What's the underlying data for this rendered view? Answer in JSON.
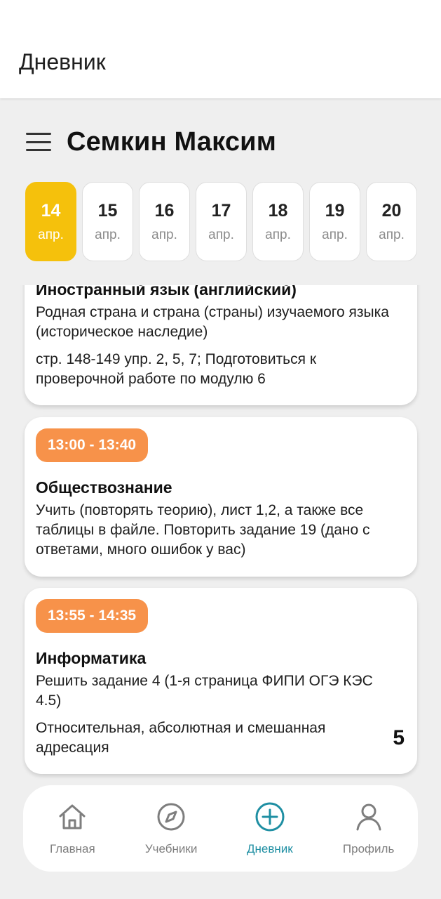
{
  "app_bar": {
    "title": "Дневник"
  },
  "header": {
    "student_name": "Семкин Максим"
  },
  "dates": [
    {
      "day": "14",
      "month": "апр.",
      "active": true
    },
    {
      "day": "15",
      "month": "апр.",
      "active": false
    },
    {
      "day": "16",
      "month": "апр.",
      "active": false
    },
    {
      "day": "17",
      "month": "апр.",
      "active": false
    },
    {
      "day": "18",
      "month": "апр.",
      "active": false
    },
    {
      "day": "19",
      "month": "апр.",
      "active": false
    },
    {
      "day": "20",
      "month": "апр.",
      "active": false
    }
  ],
  "lessons": [
    {
      "time": "",
      "subject": "Иностранный язык (английский)",
      "topic": "Родная страна и страна (страны) изучаемого языка (историческое наследие)",
      "homework": "стр. 148-149 упр. 2, 5, 7; Подготовиться к проверочной работе по модулю 6",
      "grade": ""
    },
    {
      "time": "13:00 - 13:40",
      "subject": "Обществознание",
      "topic": "Учить (повторять теорию), лист 1,2, а также все таблицы в файле. Повторить задание 19 (дано с ответами, много ошибок у вас)",
      "homework": "",
      "grade": ""
    },
    {
      "time": "13:55 - 14:35",
      "subject": "Информатика",
      "topic": "Решить задание 4 (1-я страница ФИПИ ОГЭ КЭС 4.5)",
      "homework": "Относительная, абсолютная и смешанная адресация",
      "grade": "5"
    }
  ],
  "bottom_nav": [
    {
      "label": "Главная",
      "icon": "home-icon",
      "active": false
    },
    {
      "label": "Учебники",
      "icon": "compass-icon",
      "active": false
    },
    {
      "label": "Дневник",
      "icon": "plus-circle-icon",
      "active": true
    },
    {
      "label": "Профиль",
      "icon": "profile-icon",
      "active": false
    }
  ],
  "colors": {
    "active_date": "#f5c10c",
    "time_badge": "#f7924a",
    "nav_active": "#1f8fa3",
    "background": "#efefef"
  }
}
